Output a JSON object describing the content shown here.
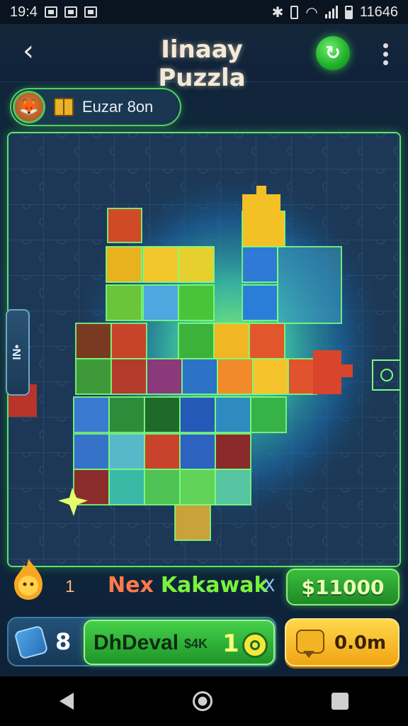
{
  "status_bar": {
    "time": "19:4",
    "right_text": "11646"
  },
  "header": {
    "title": "Iinaay Puzzla",
    "back_icon": "back-arrow-icon",
    "refresh_icon": "refresh-icon",
    "more_icon": "more-vertical-icon"
  },
  "player": {
    "name": "Euzar 8on"
  },
  "side_tab": {
    "label": "IN•"
  },
  "next": {
    "count": "1",
    "label_a": "Nex",
    "label_b": "Kakawak",
    "close": "X"
  },
  "price_button": {
    "label": "$11000"
  },
  "action_bar": {
    "count": "8",
    "label": "DhDeval",
    "small": "$4K",
    "value": "1"
  },
  "yellow_button": {
    "label": "0.0m"
  },
  "colors": {
    "accent_green": "#49d65a",
    "board_bg": "#193450",
    "price_green": "#2aa530",
    "gold": "#f0a414"
  }
}
